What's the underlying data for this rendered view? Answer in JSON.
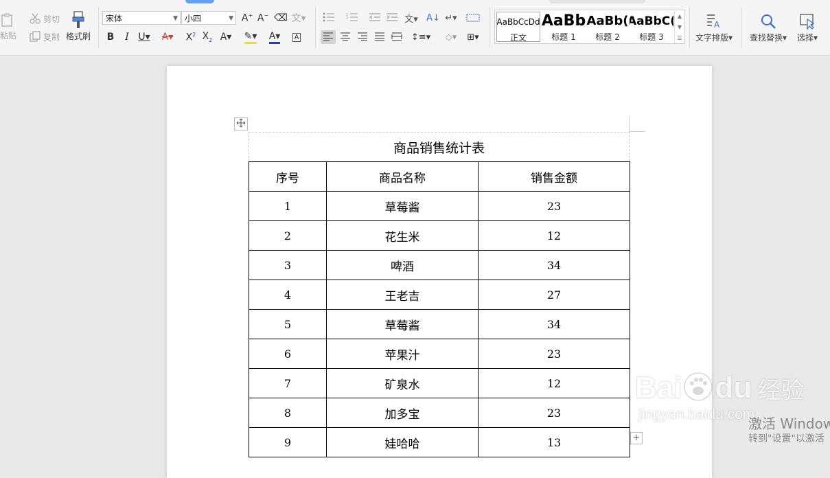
{
  "ribbon": {
    "clipboard": {
      "paste_label": "粘贴",
      "cut_label": "剪切",
      "copy_label": "复制",
      "format_painter_label": "格式刷"
    },
    "font": {
      "name": "宋体",
      "size": "小四"
    },
    "styles": [
      {
        "preview": "AaBbCcDd",
        "label": "正文",
        "selected": true
      },
      {
        "preview": "AaBb",
        "label": "标题 1"
      },
      {
        "preview": "AaBb(",
        "label": "标题 2"
      },
      {
        "preview": "AaBbC(",
        "label": "标题 3"
      }
    ],
    "text_layout_label": "文字排版",
    "find_replace_label": "查找替换",
    "select_label": "选择",
    "colors": {
      "font_color": "#1f3bd8",
      "highlight": "#f3e200",
      "accent": "#6c9ef0"
    }
  },
  "document": {
    "table_title": "商品销售统计表",
    "headers": [
      "序号",
      "商品名称",
      "销售金额"
    ],
    "rows": [
      [
        "1",
        "草莓酱",
        "23"
      ],
      [
        "2",
        "花生米",
        "12"
      ],
      [
        "3",
        "啤酒",
        "34"
      ],
      [
        "4",
        "王老吉",
        "27"
      ],
      [
        "5",
        "草莓酱",
        "34"
      ],
      [
        "6",
        "苹果汁",
        "23"
      ],
      [
        "7",
        "矿泉水",
        "12"
      ],
      [
        "8",
        "加多宝",
        "23"
      ],
      [
        "9",
        "娃哈哈",
        "13"
      ]
    ]
  },
  "watermark": {
    "brand": "Bai",
    "brand_cn": "经验",
    "url": "jingyan.baidu.com"
  },
  "activation": {
    "title": "激活 Windows",
    "subtitle": "转到\"设置\"以激活"
  }
}
